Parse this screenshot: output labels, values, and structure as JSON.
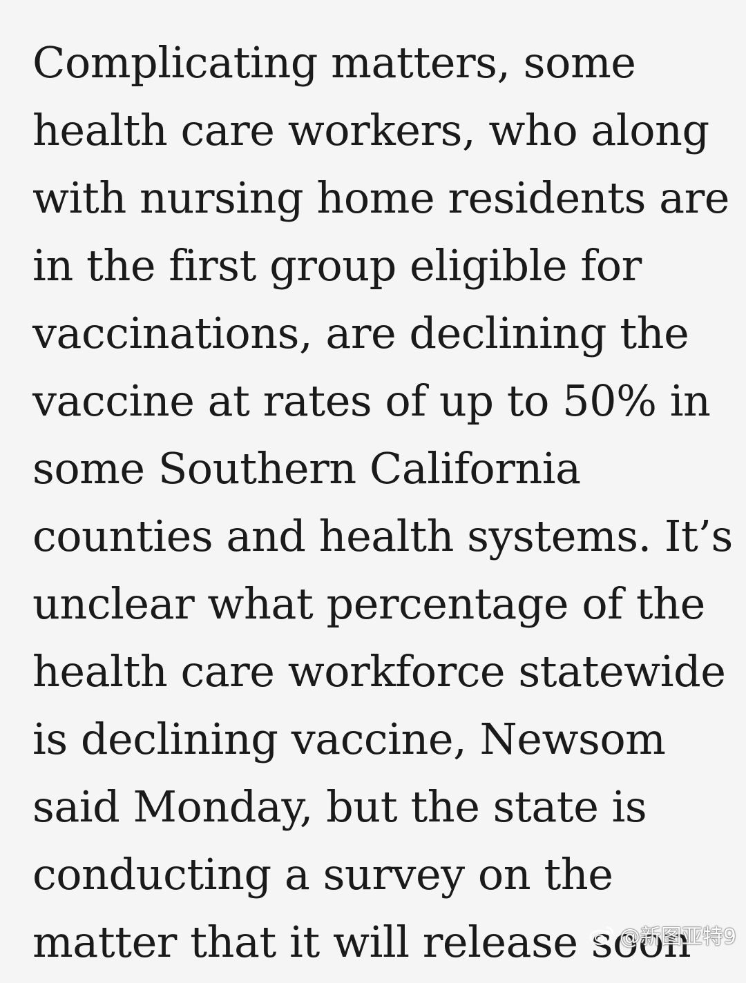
{
  "article": {
    "lines": [
      "Complicating matters, some",
      "health care workers, who along",
      "with nursing home residents are",
      "in the first group eligible for",
      "vaccinations, are declining the",
      "vaccine at rates of up to 50% in",
      "some Southern California",
      "counties and health systems. It’s",
      "unclear what percentage of the",
      "health care workforce statewide",
      "is declining vaccine, Newsom",
      "said Monday, but the state is",
      "conducting a survey on the",
      "matter that it will release soon"
    ]
  },
  "watermark": {
    "icon": "weibo-logo-icon",
    "text": "@新图亚特9"
  }
}
